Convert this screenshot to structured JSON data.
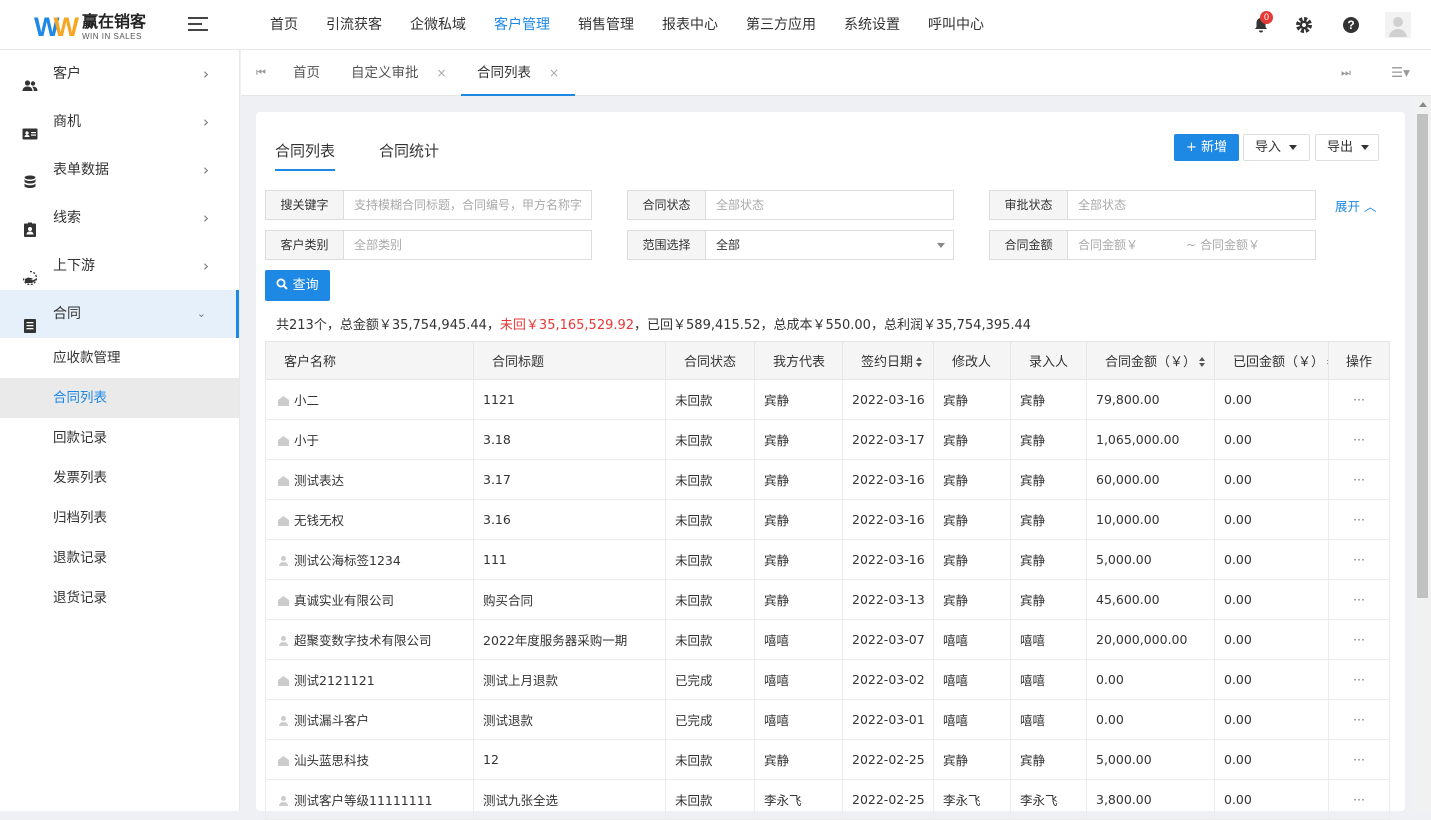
{
  "app": {
    "logo_cn": "赢在销客",
    "logo_en": "WIN IN SALES",
    "notification_count": "0"
  },
  "topnav": [
    "首页",
    "引流获客",
    "企微私域",
    "客户管理",
    "销售管理",
    "报表中心",
    "第三方应用",
    "系统设置",
    "呼叫中心"
  ],
  "topnav_active": "客户管理",
  "sidebar": {
    "items": [
      {
        "label": "客户",
        "icon": "users-icon"
      },
      {
        "label": "商机",
        "icon": "id-card-icon"
      },
      {
        "label": "表单数据",
        "icon": "database-icon"
      },
      {
        "label": "线索",
        "icon": "contact-badge-icon"
      },
      {
        "label": "上下游",
        "icon": "hand-icon"
      },
      {
        "label": "合同",
        "icon": "document-list-icon"
      }
    ],
    "subitems": [
      "应收款管理",
      "合同列表",
      "回款记录",
      "发票列表",
      "归档列表",
      "退款记录",
      "退货记录"
    ]
  },
  "tabs": [
    {
      "label": "首页"
    },
    {
      "label": "自定义审批",
      "close": "×"
    },
    {
      "label": "合同列表",
      "close": "×"
    }
  ],
  "content": {
    "tabs": [
      "合同列表",
      "合同统计"
    ],
    "new_button": "+ 新增",
    "import_button": "导入",
    "export_button": "导出",
    "filters": {
      "keyword_label": "搜关键字",
      "keyword_placeholder": "支持模糊合同标题，合同编号，甲方名称字",
      "status_label": "合同状态",
      "status_placeholder": "全部状态",
      "approval_label": "审批状态",
      "approval_placeholder": "全部状态",
      "customer_type_label": "客户类别",
      "customer_type_placeholder": "全部类别",
      "scope_label": "范围选择",
      "scope_value": "全部",
      "amount_label": "合同金额",
      "amount_min_placeholder": "合同金额￥",
      "amount_sep": "~",
      "amount_max_placeholder": "合同金额￥"
    },
    "expand_label": "展开",
    "query_button": "查询",
    "summary": {
      "part1": "共213个，总金额￥35,754,945.44，",
      "part2": "未回￥35,165,529.92",
      "part3": "，已回￥589,415.52，总成本￥550.00，总利润￥35,754,395.44"
    }
  },
  "table": {
    "headers": [
      "客户名称",
      "合同标题",
      "合同状态",
      "我方代表",
      "签约日期",
      "修改人",
      "录入人",
      "合同金额（￥）",
      "已回金额（￥）",
      "操作"
    ],
    "rows": [
      {
        "customer": "小二",
        "type": "company",
        "title": "1121",
        "status": "未回款",
        "rep": "宾静",
        "date": "2022-03-16",
        "modifier": "宾静",
        "creator": "宾静",
        "amount": "79,800.00",
        "received": "0.00",
        "ops": "···"
      },
      {
        "customer": "小于",
        "type": "company",
        "title": "3.18",
        "status": "未回款",
        "rep": "宾静",
        "date": "2022-03-17",
        "modifier": "宾静",
        "creator": "宾静",
        "amount": "1,065,000.00",
        "received": "0.00",
        "ops": "···"
      },
      {
        "customer": "测试表达",
        "type": "company",
        "title": "3.17",
        "status": "未回款",
        "rep": "宾静",
        "date": "2022-03-16",
        "modifier": "宾静",
        "creator": "宾静",
        "amount": "60,000.00",
        "received": "0.00",
        "ops": "···"
      },
      {
        "customer": "无钱无权",
        "type": "company",
        "title": "3.16",
        "status": "未回款",
        "rep": "宾静",
        "date": "2022-03-16",
        "modifier": "宾静",
        "creator": "宾静",
        "amount": "10,000.00",
        "received": "0.00",
        "ops": "···"
      },
      {
        "customer": "测试公海标签1234",
        "type": "person",
        "title": "111",
        "status": "未回款",
        "rep": "宾静",
        "date": "2022-03-16",
        "modifier": "宾静",
        "creator": "宾静",
        "amount": "5,000.00",
        "received": "0.00",
        "ops": "···"
      },
      {
        "customer": "真诚实业有限公司",
        "type": "company",
        "title": "购买合同",
        "status": "未回款",
        "rep": "宾静",
        "date": "2022-03-13",
        "modifier": "宾静",
        "creator": "宾静",
        "amount": "45,600.00",
        "received": "0.00",
        "ops": "···"
      },
      {
        "customer": "超聚变数字技术有限公司",
        "type": "person",
        "title": "2022年度服务器采购一期",
        "status": "未回款",
        "rep": "嘻嘻",
        "date": "2022-03-07",
        "modifier": "嘻嘻",
        "creator": "嘻嘻",
        "amount": "20,000,000.00",
        "received": "0.00",
        "ops": "···"
      },
      {
        "customer": "测试2121121",
        "type": "company",
        "title": "测试上月退款",
        "status": "已完成",
        "rep": "嘻嘻",
        "date": "2022-03-02",
        "modifier": "嘻嘻",
        "creator": "嘻嘻",
        "amount": "0.00",
        "received": "0.00",
        "ops": "···"
      },
      {
        "customer": "测试漏斗客户",
        "type": "person",
        "title": "测试退款",
        "status": "已完成",
        "rep": "嘻嘻",
        "date": "2022-03-01",
        "modifier": "嘻嘻",
        "creator": "嘻嘻",
        "amount": "0.00",
        "received": "0.00",
        "ops": "···"
      },
      {
        "customer": "汕头蓝思科技",
        "type": "company",
        "title": "12",
        "status": "未回款",
        "rep": "宾静",
        "date": "2022-02-25",
        "modifier": "宾静",
        "creator": "宾静",
        "amount": "5,000.00",
        "received": "0.00",
        "ops": "···"
      },
      {
        "customer": "测试客户等级11111111",
        "type": "person",
        "title": "测试九张全选",
        "status": "未回款",
        "rep": "李永飞",
        "date": "2022-02-25",
        "modifier": "李永飞",
        "creator": "李永飞",
        "amount": "3,800.00",
        "received": "0.00",
        "ops": "···"
      }
    ]
  },
  "colors": {
    "accent": "#1e88e5",
    "danger": "#e53935",
    "logo_orange": "#f5a623"
  }
}
